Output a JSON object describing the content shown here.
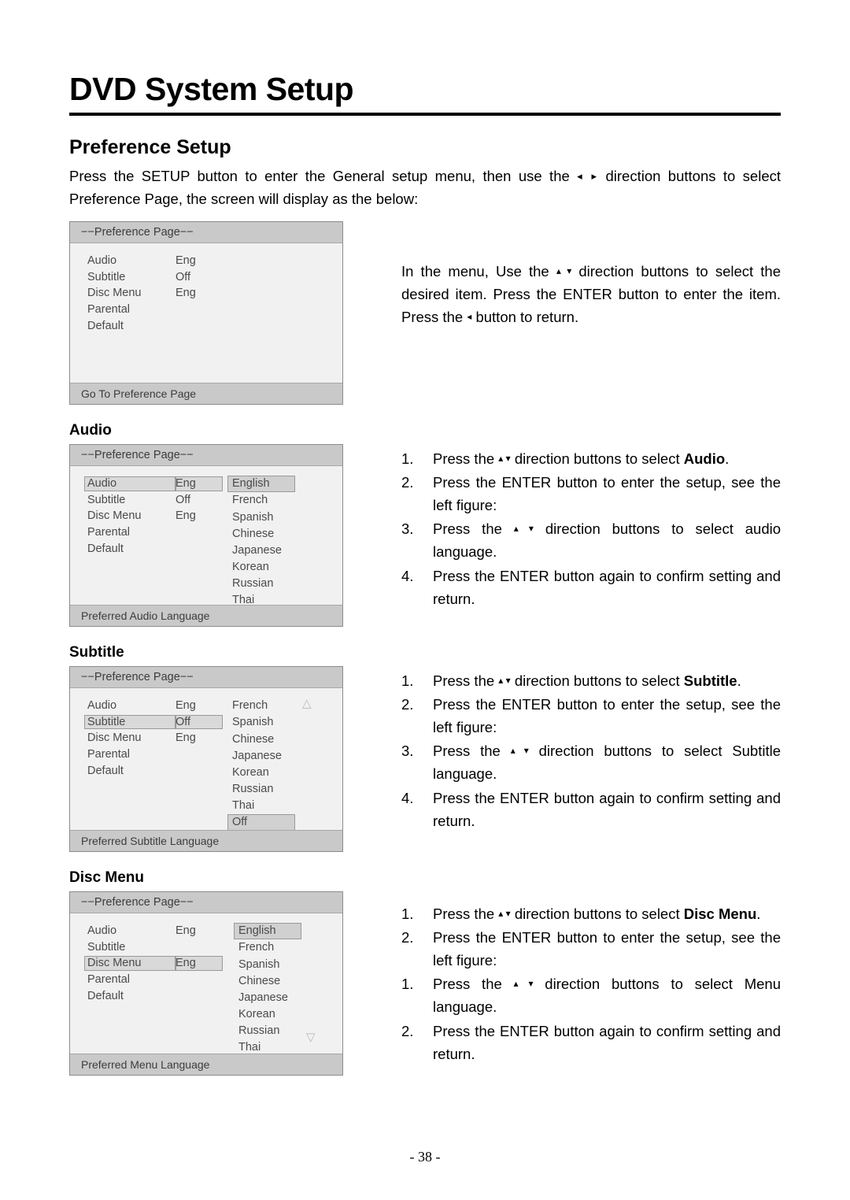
{
  "header": {
    "title": "DVD System Setup",
    "section": "Preference Setup"
  },
  "intro": {
    "part1": "Press the SETUP button to enter the General setup menu, then use the",
    "arrows": "◂ ▸",
    "part2": "direction buttons to select Preference Page, the screen will display as the below:"
  },
  "osd_common": {
    "page_header": "−−Preference Page−−",
    "items": [
      "Audio",
      "Subtitle",
      "Disc Menu",
      "Parental",
      "Default"
    ],
    "values": [
      "Eng",
      "Off",
      "Eng",
      "",
      ""
    ]
  },
  "screens": [
    {
      "name": "preference-page",
      "footer": "Go To Preference Page",
      "selected": -1,
      "options": [],
      "highlight": -1
    },
    {
      "name": "audio",
      "footer": "Preferred Audio Language",
      "selected": 0,
      "options": [
        "English",
        "French",
        "Spanish",
        "Chinese",
        "Japanese",
        "Korean",
        "Russian",
        "Thai"
      ],
      "highlight": 0
    },
    {
      "name": "subtitle",
      "footer": "Preferred Subtitle Language",
      "selected": 1,
      "options": [
        "French",
        "Spanish",
        "Chinese",
        "Japanese",
        "Korean",
        "Russian",
        "Thai",
        "Off"
      ],
      "highlight": 7
    },
    {
      "name": "disc-menu",
      "footer": "Preferred Menu Language",
      "selected": 2,
      "options": [
        "English",
        "French",
        "Spanish",
        "Chinese",
        "Japanese",
        "Korean",
        "Russian",
        "Thai"
      ],
      "highlight": 0
    }
  ],
  "intro_note": {
    "l1": "In  the  menu,  Use  the",
    "arrows": "▴ ▾",
    "l2": "direction  buttons  to select the desired item. Press the ENTER button to enter the item. Press the",
    "arrow2": "◂",
    "l3": "button to return."
  },
  "sections": [
    {
      "heading": "Audio",
      "steps": [
        {
          "num": "1.",
          "pre": "Press  the",
          "arrows": "▴ ▾",
          "post": "direction  buttons  to  select",
          "bold": "Audio",
          "tail": "."
        },
        {
          "num": "2.",
          "pre": "Press the ENTER button to enter the setup, see the left figure:",
          "arrows": "",
          "post": "",
          "bold": "",
          "tail": ""
        },
        {
          "num": "3.",
          "pre": "Press the",
          "arrows": "▴ ▾",
          "post": "direction buttons to select audio language.",
          "bold": "",
          "tail": ""
        },
        {
          "num": "4.",
          "pre": "Press  the  ENTER  button  again  to  confirm setting and return.",
          "arrows": "",
          "post": "",
          "bold": "",
          "tail": ""
        }
      ]
    },
    {
      "heading": "Subtitle",
      "steps": [
        {
          "num": "1.",
          "pre": "Press  the",
          "arrows": "▴ ▾",
          "post": "direction  buttons  to  select",
          "bold": "Subtitle",
          "tail": "."
        },
        {
          "num": "2.",
          "pre": "Press the ENTER button to enter the setup, see the left figure:",
          "arrows": "",
          "post": "",
          "bold": "",
          "tail": ""
        },
        {
          "num": "3.",
          "pre": "Press  the",
          "arrows": "▴ ▾",
          "post": "direction  buttons  to  select Subtitle language.",
          "bold": "",
          "tail": ""
        },
        {
          "num": "4.",
          "pre": "Press  the  ENTER  button  again  to  confirm setting and return.",
          "arrows": "",
          "post": "",
          "bold": "",
          "tail": ""
        }
      ]
    },
    {
      "heading": "Disc Menu",
      "steps": [
        {
          "num": "1.",
          "pre": "Press the",
          "arrows": "▴ ▾",
          "post": "direction buttons to select",
          "bold": "Disc Menu",
          "tail": "."
        },
        {
          "num": "2.",
          "pre": "Press the ENTER button to enter the setup, see the left figure:",
          "arrows": "",
          "post": "",
          "bold": "",
          "tail": ""
        },
        {
          "num": "1.",
          "pre": "Press the",
          "arrows": "▴ ▾",
          "post": "direction buttons to select Menu language.",
          "bold": "",
          "tail": ""
        },
        {
          "num": "2.",
          "pre": "Press  the  ENTER  button  again  to  confirm setting and return.",
          "arrows": "",
          "post": "",
          "bold": "",
          "tail": ""
        }
      ]
    }
  ],
  "footer": "- 38 -"
}
